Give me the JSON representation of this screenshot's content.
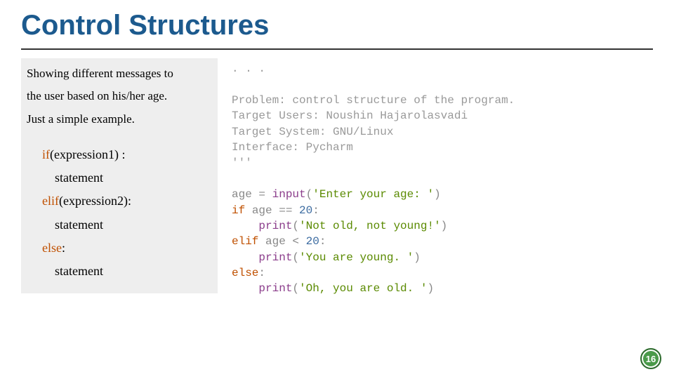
{
  "title": "Control Structures",
  "desc": {
    "line1": "Showing different messages to",
    "line2": "the user based on his/her age.",
    "line3": "Just a simple example."
  },
  "syntax": {
    "if_kw": "if",
    "if_rest": "(expression1) :",
    "stmt": "statement",
    "elif_kw": "elif",
    "elif_rest": "(expression2):",
    "else_kw": "else",
    "else_rest": ":"
  },
  "code": {
    "doc_open": ". . .",
    "doc_l1": "Problem: control structure of the program.",
    "doc_l2": "Target Users: Noushin Hajarolasvadi",
    "doc_l3": "Target System: GNU/Linux",
    "doc_l4": "Interface: Pycharm",
    "doc_close": "'''",
    "l1a": "age = ",
    "l1b": "input",
    "l1c": "(",
    "l1d": "'Enter your age: '",
    "l1e": ")",
    "l2a": "if ",
    "l2b": "age == ",
    "l2c": "20",
    "l2d": ":",
    "l3a": "    ",
    "l3b": "print",
    "l3c": "(",
    "l3d": "'Not old, not young!'",
    "l3e": ")",
    "l4a": "elif ",
    "l4b": "age < ",
    "l4c": "20",
    "l4d": ":",
    "l5a": "    ",
    "l5b": "print",
    "l5c": "(",
    "l5d": "'You are young. '",
    "l5e": ")",
    "l6a": "else",
    "l6b": ":",
    "l7a": "    ",
    "l7b": "print",
    "l7c": "(",
    "l7d": "'Oh, you are old. '",
    "l7e": ")"
  },
  "page": "16"
}
